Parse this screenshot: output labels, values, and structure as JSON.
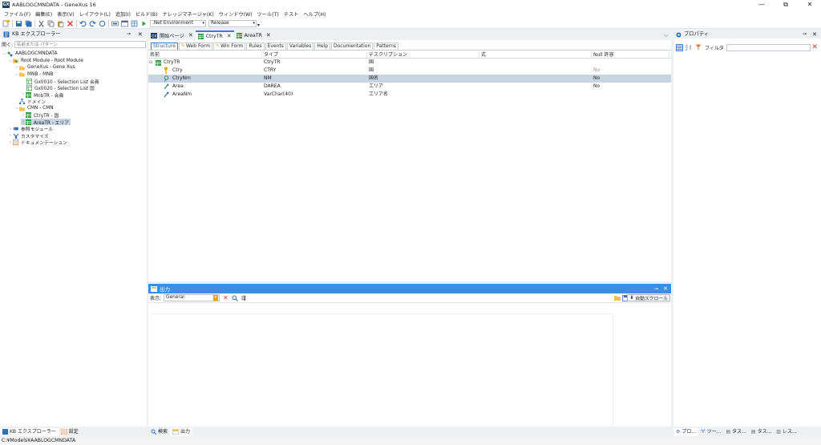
{
  "window": {
    "title": "AABLOGCMNDATA - GeneXus 16",
    "app_icon_label": "GX",
    "controls": [
      "—",
      "⧉",
      "✕"
    ]
  },
  "menu": [
    "ファイル(F)",
    "編集(E)",
    "表示(V)",
    "レイアウト(L)",
    "追加(I)",
    "ビルド(B)",
    "ナレッジマネージャ(K)",
    "ウィンドウ(W)",
    "ツール(T)",
    "テスト",
    "ヘルプ(H)"
  ],
  "toolbar": {
    "environment": ".Net Environment",
    "configuration": "Release"
  },
  "kb_explorer": {
    "title": "KB エクスプローラー",
    "search_label": "開く:",
    "search_placeholder": "名前または パターン",
    "tree": [
      {
        "label": "AABLOGCMNDATA",
        "icon": "kb-icon"
      },
      {
        "label": "Root Module - Root Module",
        "icon": "module-folder-icon"
      },
      {
        "label": "GeneXus - Gene Xus",
        "icon": "folder-icon"
      },
      {
        "label": "MNB - MNB",
        "icon": "folder-icon"
      },
      {
        "label": "Gx0010 - Selection List 会員",
        "icon": "webpanel-icon"
      },
      {
        "label": "Gx0020 - Selection List 国",
        "icon": "webpanel-icon"
      },
      {
        "label": "MnbTR - 会員",
        "icon": "transaction-icon"
      },
      {
        "label": "ドメイン",
        "icon": "domain-icon"
      },
      {
        "label": "CMN - CMN",
        "icon": "folder-icon"
      },
      {
        "label": "CtryTR - 国",
        "icon": "transaction-icon"
      },
      {
        "label": "AreaTR - エリア",
        "icon": "transaction-icon"
      },
      {
        "label": "参照モジュール",
        "icon": "references-icon"
      },
      {
        "label": "カスタマイズ",
        "icon": "customize-icon"
      },
      {
        "label": "ドキュメンテーション",
        "icon": "documentation-icon"
      }
    ]
  },
  "doc_tabs": [
    {
      "label": "開始ページ",
      "icon": "gx-start-icon"
    },
    {
      "label": "CtryTR",
      "icon": "transaction-icon"
    },
    {
      "label": "AreaTR",
      "icon": "transaction-icon"
    }
  ],
  "sub_tabs": [
    "Structure",
    "Web Form",
    "Win Form",
    "Rules",
    "Events",
    "Variables",
    "Help",
    "Documentation",
    "Patterns"
  ],
  "structure": {
    "columns": [
      "名前",
      "タイプ",
      "デスクリプション",
      "式",
      "Null 許容"
    ],
    "rows": [
      {
        "name": "CtryTR",
        "type": "CtryTR",
        "desc": "国",
        "formula": "",
        "nullable": ""
      },
      {
        "name": "Ctry",
        "type": "CTRY",
        "desc": "国",
        "formula": "",
        "nullable": "No"
      },
      {
        "name": "CtryNm",
        "type": "NM",
        "desc": "国名",
        "formula": "",
        "nullable": "No"
      },
      {
        "name": "Area",
        "type": "DAREA",
        "desc": "エリア",
        "formula": "",
        "nullable": "No"
      },
      {
        "name": "AreaNm",
        "type": "VarChar(40)",
        "desc": "エリア名",
        "formula": "",
        "nullable": ""
      }
    ]
  },
  "output": {
    "title": "出力",
    "show_label": "表示:",
    "show_value": "General",
    "autoscroll_label": "自動スクロール"
  },
  "properties": {
    "title": "プロパティ",
    "filter_label": "フィルタ"
  },
  "bottom_left_tabs": [
    "KB エクスプローラー",
    "設定"
  ],
  "bottom_mid_tabs": [
    "検索",
    "出力"
  ],
  "bottom_right_tabs": [
    "プロ...",
    "ツー...",
    "タス...",
    "タス...",
    "レス..."
  ],
  "status": {
    "path": "C:¥Models¥AABLOGCMNDATA"
  },
  "colors": {
    "accent": "#3a7bd5",
    "selected": "#c9d4e2",
    "panel_blue": "#3a8ee6"
  }
}
